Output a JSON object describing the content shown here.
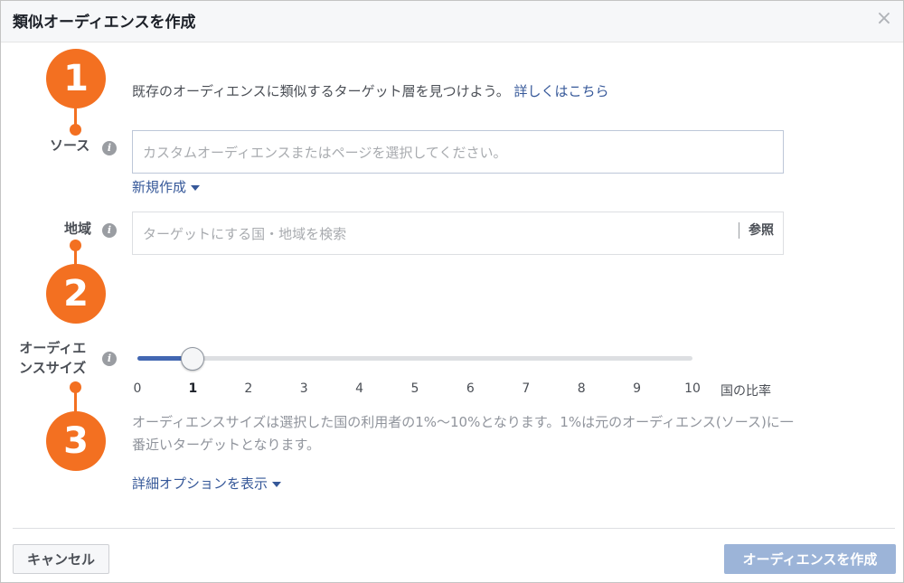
{
  "dialog": {
    "title": "類似オーディエンスを作成",
    "close_icon": "close-icon",
    "close_glyph": "×"
  },
  "intro": {
    "text": "既存のオーディエンスに類似するターゲット層を見つけよう。",
    "link": "詳しくはこちら"
  },
  "source": {
    "label": "ソース",
    "placeholder": "カスタムオーディエンスまたはページを選択してください。",
    "new_link": "新規作成"
  },
  "location": {
    "label": "地域",
    "placeholder": "ターゲットにする国・地域を検索",
    "browse": "参照"
  },
  "audience_size": {
    "label_line1": "オーディエ",
    "label_line2": "ンスサイズ",
    "selected_value": 1,
    "ticks": [
      "0",
      "1",
      "2",
      "3",
      "4",
      "5",
      "6",
      "7",
      "8",
      "9",
      "10"
    ],
    "axis_label": "国の比率",
    "description": "オーディエンスサイズは選択した国の利用者の1%〜10%となります。1%は元のオーディエンス(ソース)に一番近いターゲットとなります。",
    "advanced_link": "詳細オプションを表示"
  },
  "info_glyph": "i",
  "steps": [
    "1",
    "2",
    "3"
  ],
  "footer": {
    "cancel": "キャンセル",
    "create": "オーディエンスを作成"
  },
  "colors": {
    "accent": "#4267b2",
    "step_marker": "#f37021",
    "link": "#365899",
    "disabled_button": "#9cb4d8"
  }
}
